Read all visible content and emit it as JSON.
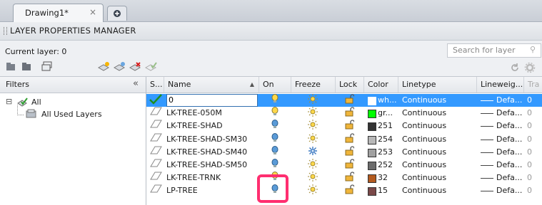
{
  "tab": {
    "label": "Drawing1*",
    "close": "×"
  },
  "panel": {
    "title": "LAYER PROPERTIES MANAGER",
    "current_layer": "Current layer: 0",
    "search_placeholder": "Search for layer"
  },
  "filters": {
    "header": "Filters",
    "tree": [
      {
        "label": "All",
        "expander": "⊟"
      },
      {
        "label": "All Used Layers"
      }
    ]
  },
  "table": {
    "columns": [
      "S...",
      "Name",
      "On",
      "Freeze",
      "Lock",
      "Color",
      "Linetype",
      "Lineweig...",
      "Tra"
    ],
    "rows": [
      {
        "status": "current",
        "name": "0",
        "on": "on",
        "freeze": "thawed",
        "lock": "unlocked",
        "color_name": "wh...",
        "color_hex": "#ffffff",
        "linetype": "Continuous",
        "lineweight": "Defa...",
        "trans": "0"
      },
      {
        "status": "",
        "name": "LK-TREE-050M",
        "on": "on",
        "freeze": "thawed",
        "lock": "unlocked",
        "color_name": "gr...",
        "color_hex": "#00ff00",
        "linetype": "Continuous",
        "lineweight": "Defa...",
        "trans": "0"
      },
      {
        "status": "",
        "name": "LK-TREE-SHAD",
        "on": "off",
        "freeze": "thawed",
        "lock": "unlocked",
        "color_name": "251",
        "color_hex": "#333333",
        "linetype": "Continuous",
        "lineweight": "Defa...",
        "trans": "0"
      },
      {
        "status": "",
        "name": "LK-TREE-SHAD-SM30",
        "on": "off",
        "freeze": "thawed",
        "lock": "unlocked",
        "color_name": "254",
        "color_hex": "#b8b8b8",
        "linetype": "Continuous",
        "lineweight": "Defa...",
        "trans": "0"
      },
      {
        "status": "",
        "name": "LK-TREE-SHAD-SM40",
        "on": "off",
        "freeze": "frozen",
        "lock": "unlocked",
        "color_name": "253",
        "color_hex": "#a0a0a0",
        "linetype": "Continuous",
        "lineweight": "Defa...",
        "trans": "0"
      },
      {
        "status": "",
        "name": "LK-TREE-SHAD-SM50",
        "on": "off",
        "freeze": "thawed",
        "lock": "unlocked",
        "color_name": "252",
        "color_hex": "#6b6b6b",
        "linetype": "Continuous",
        "lineweight": "Defa...",
        "trans": "0"
      },
      {
        "status": "",
        "name": "LK-TREE-TRNK",
        "on": "on",
        "freeze": "thawed",
        "lock": "unlocked",
        "color_name": "32",
        "color_hex": "#b35a1f",
        "linetype": "Continuous",
        "lineweight": "Defa...",
        "trans": "0"
      },
      {
        "status": "",
        "name": "LP-TREE",
        "on": "off",
        "freeze": "thawed",
        "lock": "unlocked",
        "color_name": "15",
        "color_hex": "#7a4848",
        "linetype": "Continuous",
        "lineweight": "Defa...",
        "trans": "0"
      }
    ]
  },
  "colors": {
    "selection": "#3399ff",
    "highlight": "#ff2e70"
  }
}
